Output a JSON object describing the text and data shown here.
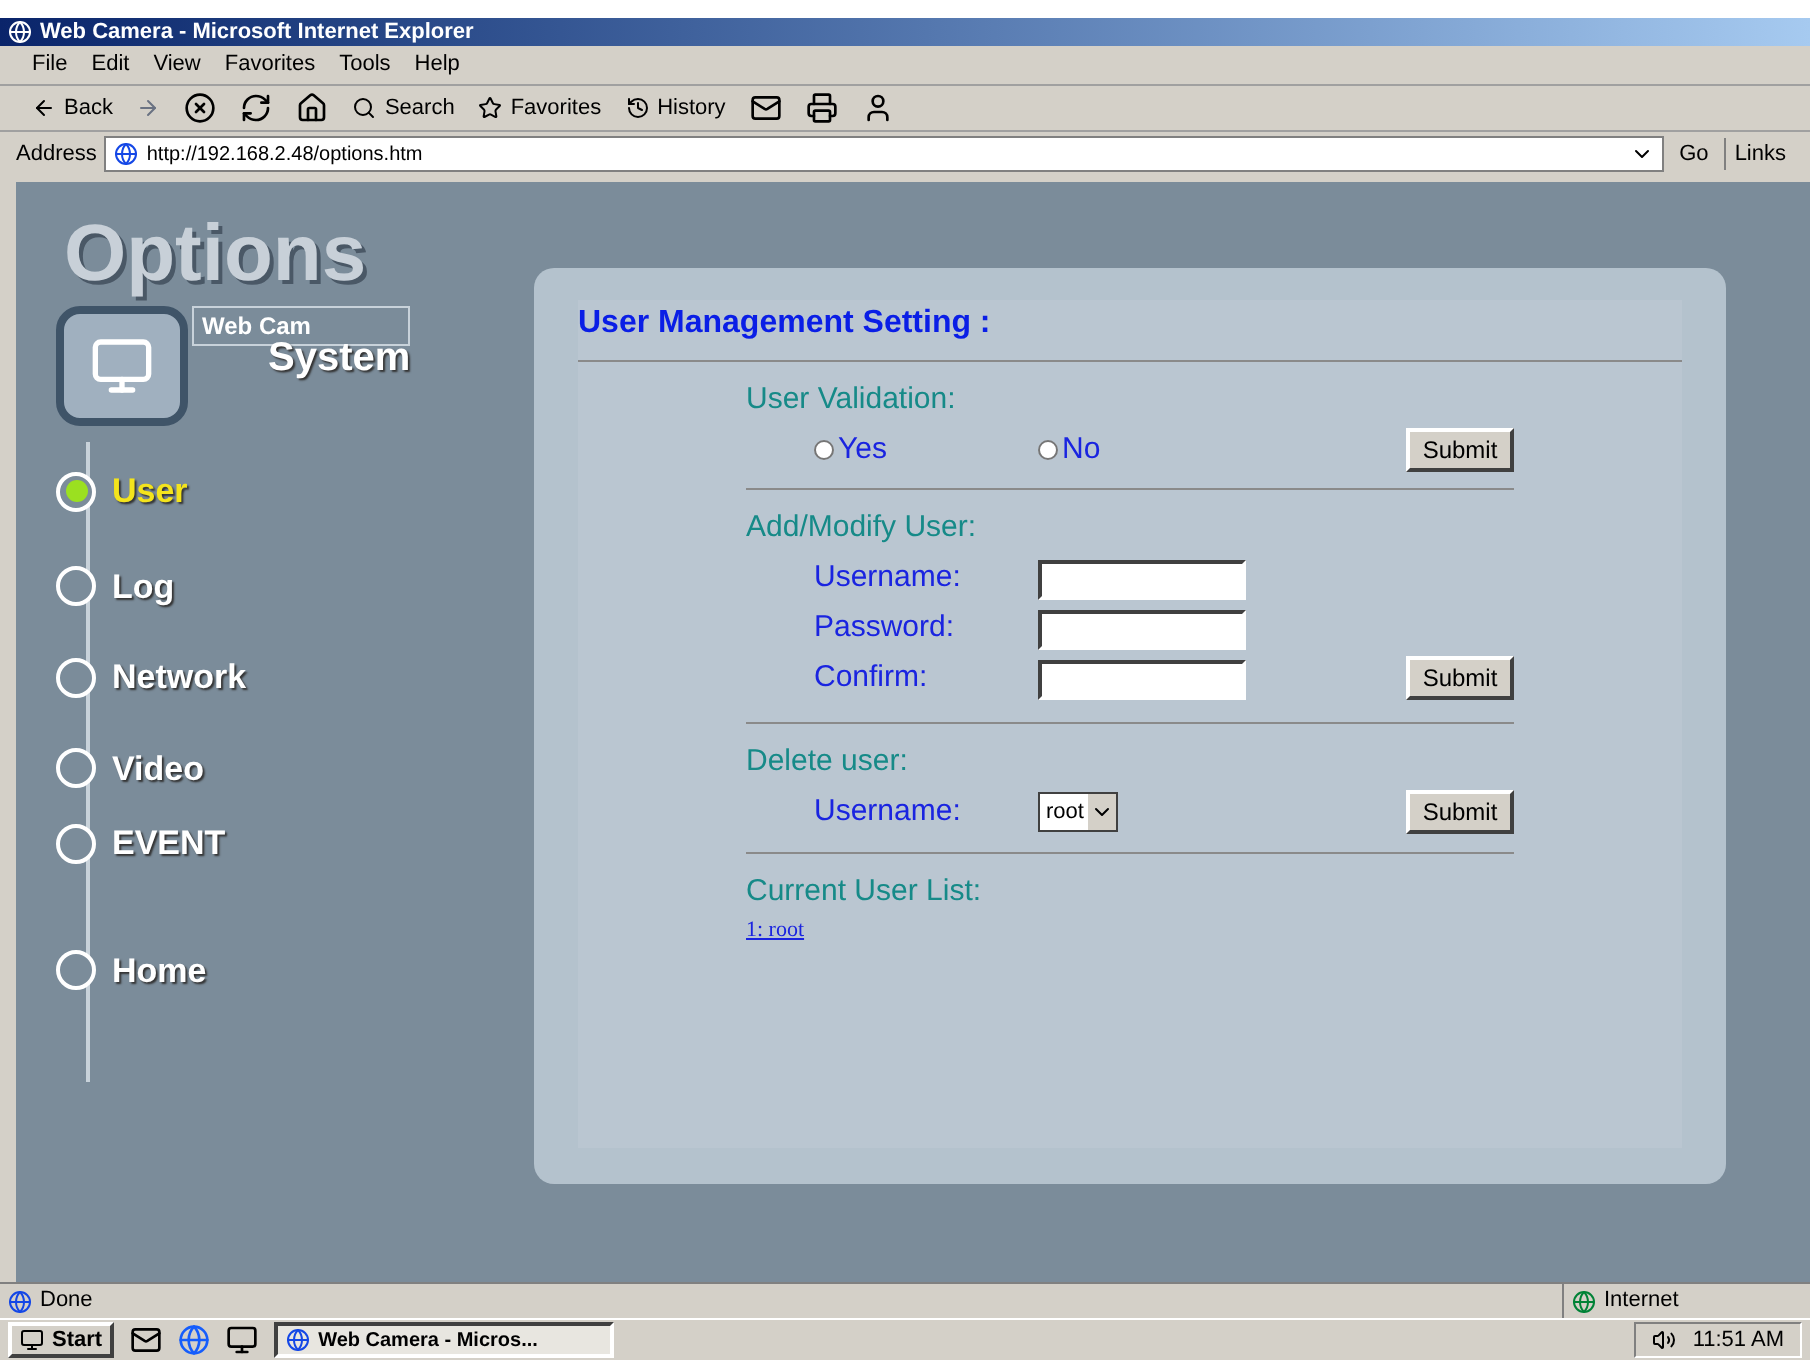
{
  "window": {
    "title": "Web Camera - Microsoft Internet Explorer"
  },
  "menu_bar": [
    "File",
    "Edit",
    "View",
    "Favorites",
    "Tools",
    "Help"
  ],
  "toolbar": {
    "back": "Back",
    "search": "Search",
    "favorites": "Favorites",
    "history": "History"
  },
  "address_bar": {
    "label": "Address",
    "url": "http://192.168.2.48/options.htm",
    "go": "Go",
    "links": "Links"
  },
  "sidebar": {
    "title": "Options",
    "logo_label": "Web Cam",
    "section": "System",
    "items": [
      {
        "label": "User",
        "selected": true
      },
      {
        "label": "Log",
        "selected": false
      },
      {
        "label": "Network",
        "selected": false
      },
      {
        "label": "Video",
        "selected": false
      },
      {
        "label": "EVENT",
        "selected": false
      },
      {
        "label": "Home",
        "selected": false
      }
    ]
  },
  "panel": {
    "title": "User Management Setting :",
    "validation": {
      "heading": "User Validation:",
      "options": [
        {
          "label": "Yes",
          "checked": false
        },
        {
          "label": "No",
          "checked": false
        }
      ],
      "submit": "Submit"
    },
    "add_user": {
      "heading": "Add/Modify User:",
      "fields": [
        {
          "label": "Username:"
        },
        {
          "label": "Password:"
        },
        {
          "label": "Confirm:"
        }
      ],
      "submit": "Submit"
    },
    "delete_user": {
      "heading": "Delete user:",
      "label": "Username:",
      "value": "root",
      "submit": "Submit"
    },
    "user_list": {
      "heading": "Current User List:",
      "users": [
        "1: root"
      ]
    }
  },
  "status_bar": {
    "text": "Done",
    "zone": "Internet"
  },
  "taskbar": {
    "start": "Start",
    "task": "Web Camera - Micros...",
    "clock": "11:51 AM"
  }
}
